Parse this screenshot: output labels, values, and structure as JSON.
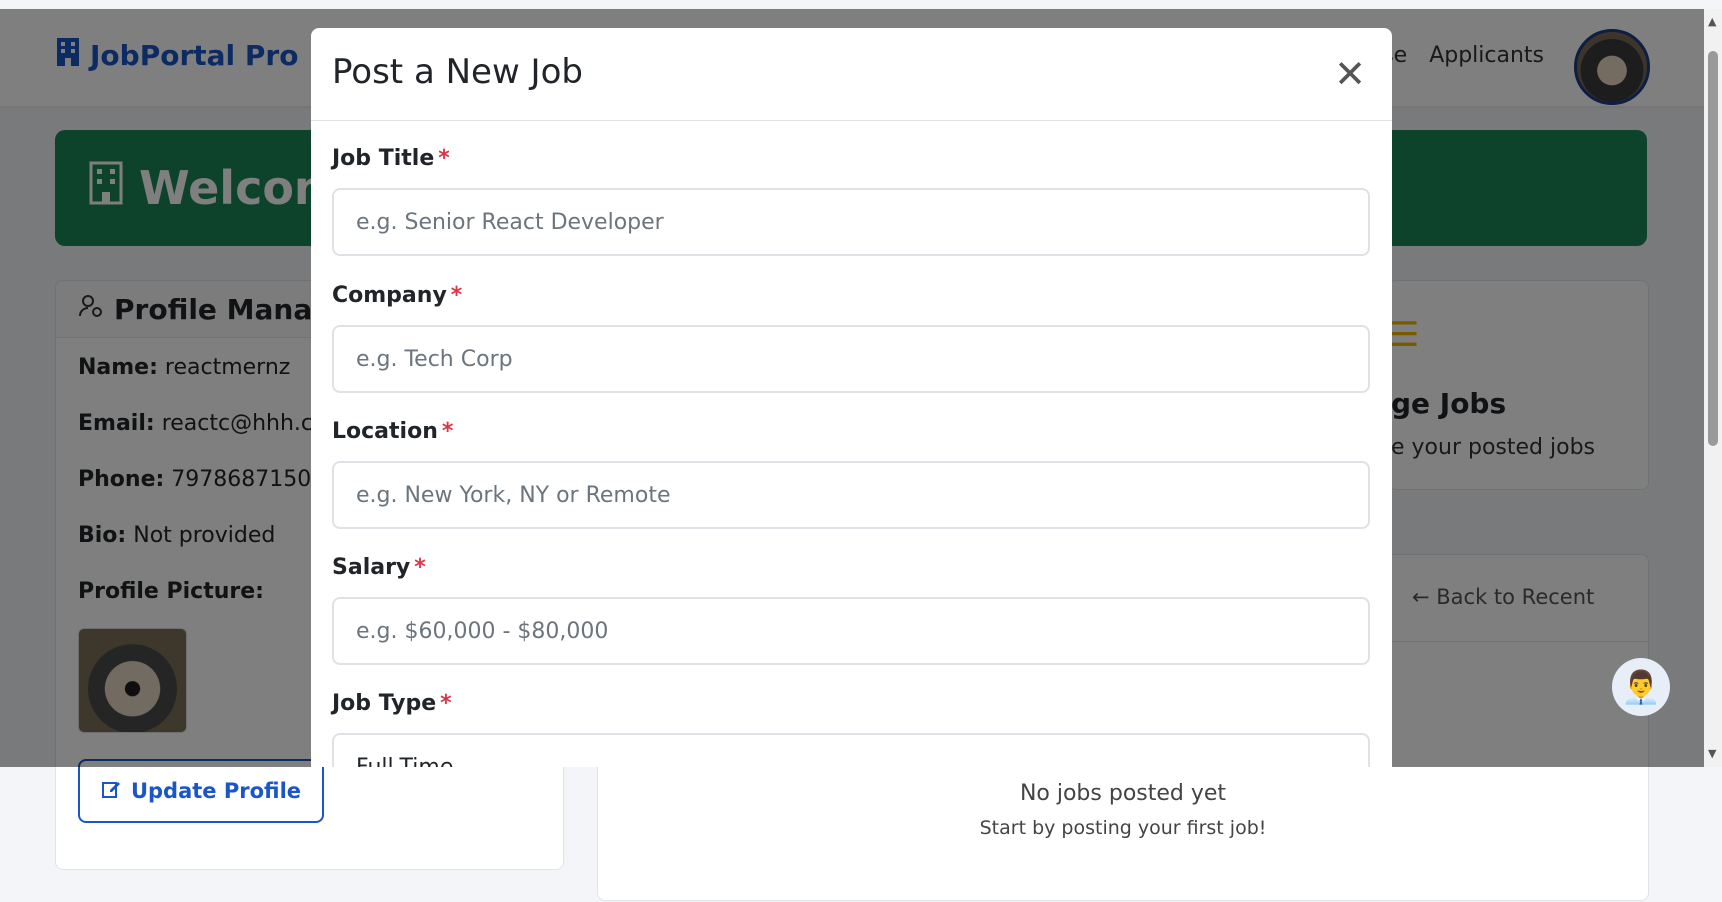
{
  "navbar": {
    "brand": "JobPortal Pro",
    "links": [
      "se",
      "Applicants"
    ]
  },
  "welcome": {
    "text": "Welcom"
  },
  "profile": {
    "title": "Profile Manage",
    "name_label": "Name:",
    "name": "reactmernz",
    "email_label": "Email:",
    "email": "reactc@hhh.co",
    "phone_label": "Phone:",
    "phone": "7978687150",
    "bio_label": "Bio:",
    "bio": "Not provided",
    "picture_label": "Profile Picture:",
    "update_button": "Update Profile"
  },
  "manage_jobs": {
    "title": "ge Jobs",
    "subtitle": "e your posted jobs"
  },
  "jobs_list": {
    "back_link": "← Back to Recent",
    "empty_title": "No jobs posted yet",
    "empty_subtitle": "Start by posting your first job!"
  },
  "modal": {
    "title": "Post a New Job",
    "close_icon": "close-icon",
    "fields": [
      {
        "label": "Job Title",
        "placeholder": "e.g. Senior React Developer"
      },
      {
        "label": "Company",
        "placeholder": "e.g. Tech Corp"
      },
      {
        "label": "Location",
        "placeholder": "e.g. New York, NY or Remote"
      },
      {
        "label": "Salary",
        "placeholder": "e.g. $60,000 - $80,000"
      },
      {
        "label": "Job Type",
        "value": "Full-Time"
      }
    ],
    "required_marker": "*"
  },
  "colors": {
    "brand": "#1a56c7",
    "welcome_bg": "#198754",
    "required": "#dc3545"
  }
}
